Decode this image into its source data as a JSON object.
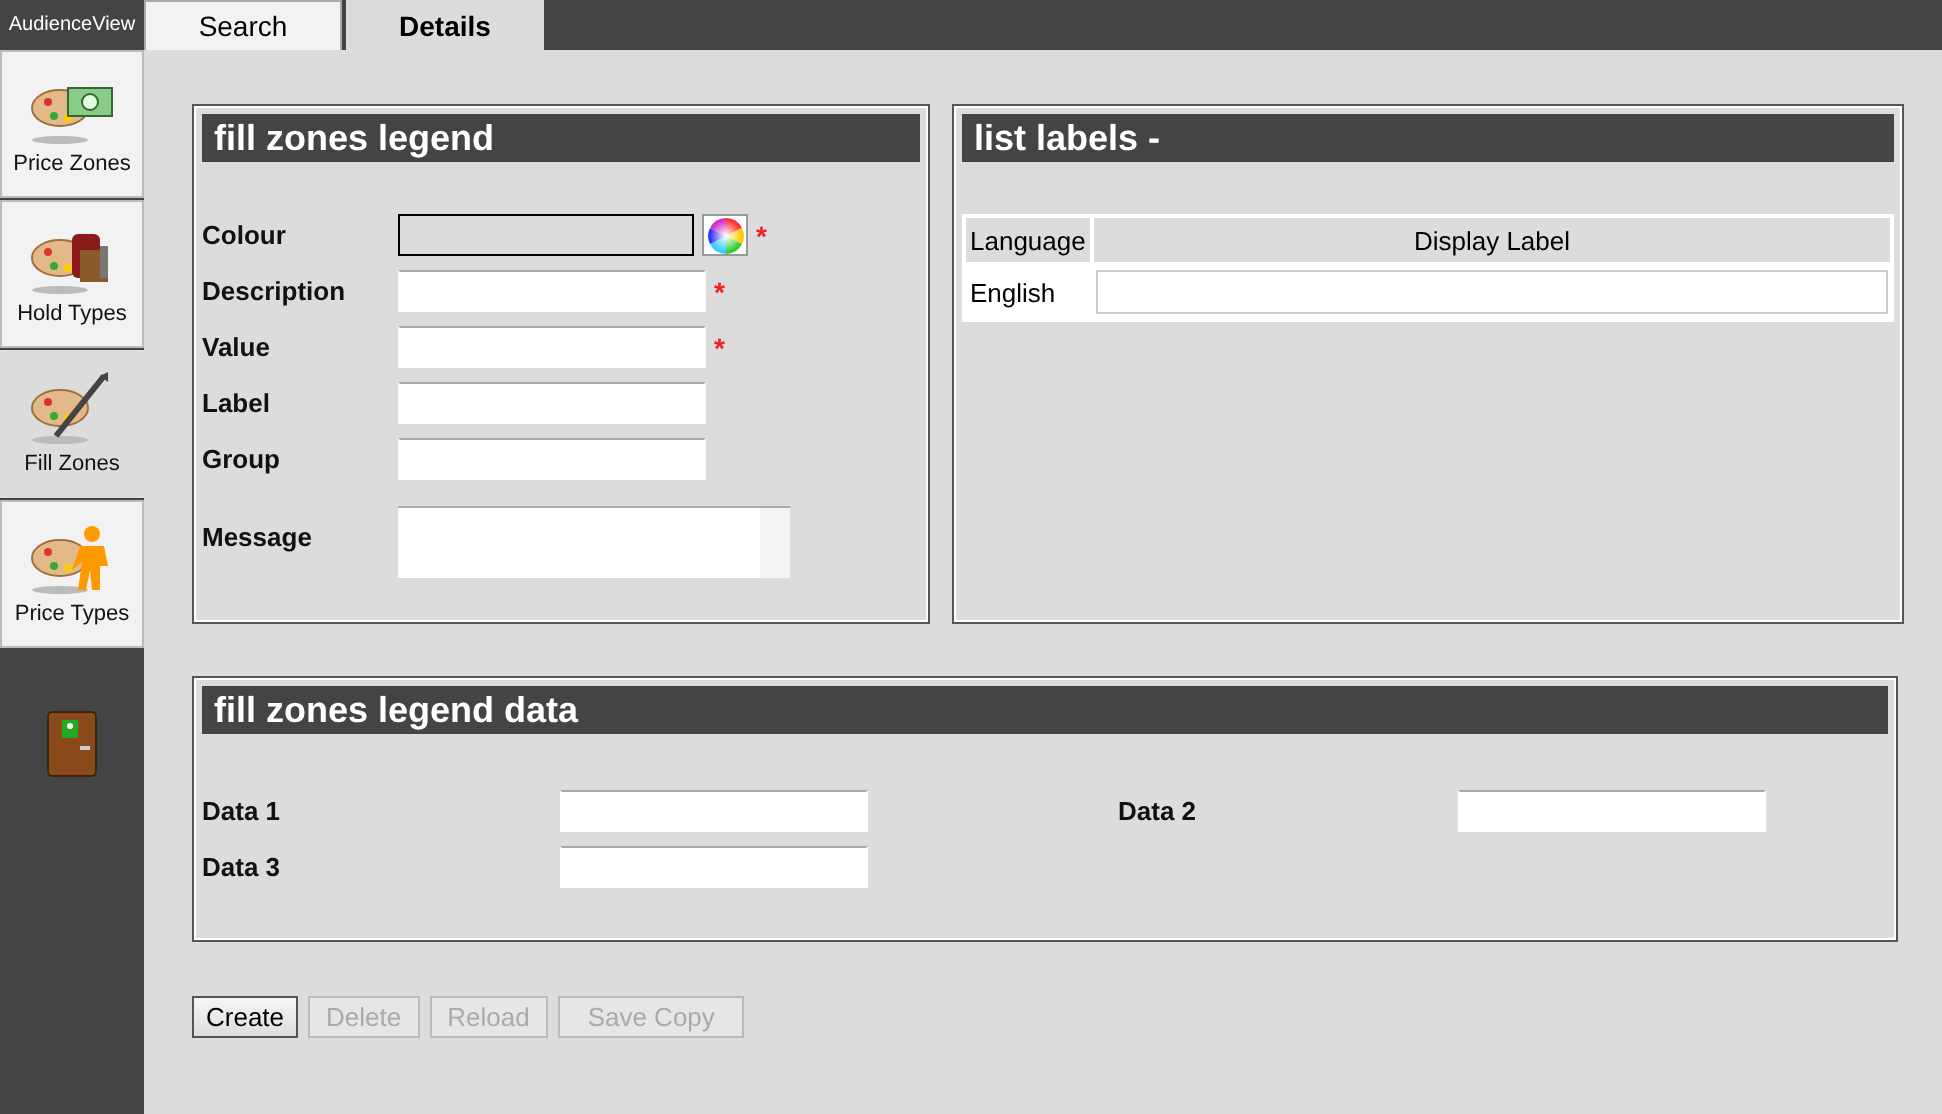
{
  "brand": "AudienceView",
  "tabs": [
    {
      "label": "Search",
      "selected": false
    },
    {
      "label": "Details",
      "selected": true
    }
  ],
  "sidebar": {
    "items": [
      {
        "label": "Price Zones",
        "kind": "money",
        "selected": false
      },
      {
        "label": "Hold Types",
        "kind": "hold",
        "selected": false
      },
      {
        "label": "Fill Zones",
        "kind": "brush",
        "selected": true
      },
      {
        "label": "Price Types",
        "kind": "person",
        "selected": false
      }
    ]
  },
  "fill_zones_legend": {
    "title": "fill zones legend",
    "fields": [
      {
        "label": "Colour",
        "kind": "colour",
        "required_mark": "*"
      },
      {
        "label": "Description",
        "kind": "text",
        "required_mark": "*"
      },
      {
        "label": "Value",
        "kind": "text",
        "required_mark": "*"
      },
      {
        "label": "Label",
        "kind": "text"
      },
      {
        "label": "Group",
        "kind": "text"
      },
      {
        "label": "Message",
        "kind": "textarea"
      }
    ]
  },
  "list_labels": {
    "title": "list labels -",
    "columns": [
      "Language",
      "Display Label"
    ],
    "rows": [
      {
        "language": "English"
      }
    ]
  },
  "legend_data": {
    "title": "fill zones legend data",
    "fields": [
      {
        "label": "Data 1"
      },
      {
        "label": "Data 2"
      },
      {
        "label": "Data 3"
      }
    ]
  },
  "buttons": [
    {
      "label": "Create",
      "disabled": false
    },
    {
      "label": "Delete",
      "disabled": true
    },
    {
      "label": "Reload",
      "disabled": true
    },
    {
      "label": "Save Copy",
      "disabled": true
    }
  ]
}
